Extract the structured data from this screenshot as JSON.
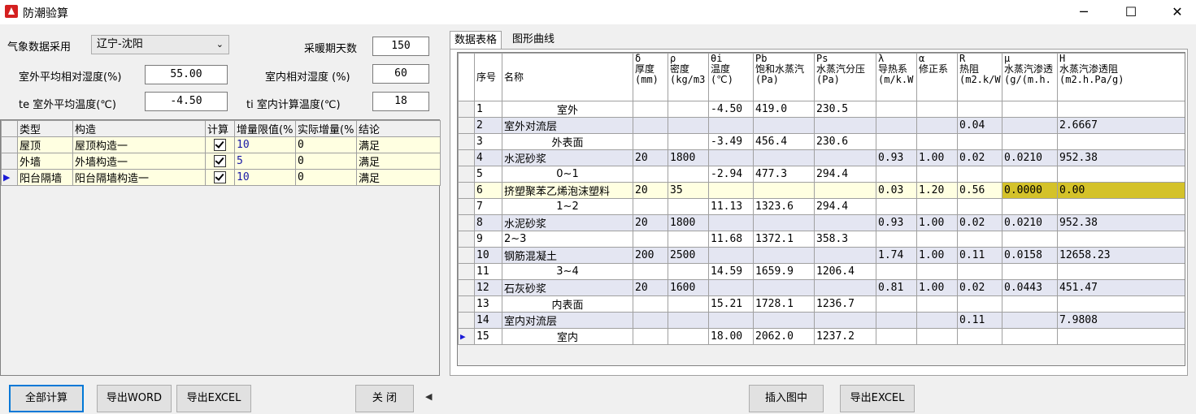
{
  "window": {
    "title": "防潮验算",
    "minimize": "─",
    "maximize": "☐",
    "close": "✕"
  },
  "form": {
    "region_label": "气象数据采用",
    "region_value": "辽宁-沈阳",
    "heating_days_label": "采暖期天数",
    "heating_days_value": "150",
    "outdoor_rh_label": "室外平均相对湿度(%)",
    "outdoor_rh_value": "55.00",
    "indoor_rh_label": "室内相对湿度 (%)",
    "indoor_rh_value": "60",
    "te_label": "te 室外平均温度(℃)",
    "te_value": "-4.50",
    "ti_label": "ti 室内计算温度(℃)",
    "ti_value": "18"
  },
  "left_table": {
    "headers": [
      "类型",
      "构造",
      "计算",
      "增量限值(%",
      "实际增量(%",
      "结论"
    ],
    "rows": [
      {
        "type": "屋顶",
        "construction": "屋顶构造一",
        "limit": "10",
        "actual": "0",
        "result": "满足"
      },
      {
        "type": "外墙",
        "construction": "外墙构造一",
        "limit": "5",
        "actual": "0",
        "result": "满足"
      },
      {
        "type": "阳台隔墙",
        "construction": "阳台隔墙构造一",
        "limit": "10",
        "actual": "0",
        "result": "满足"
      }
    ]
  },
  "tabs": [
    "数据表格",
    "图形曲线"
  ],
  "right_table": {
    "headers": [
      [
        "序号"
      ],
      [
        "名称"
      ],
      [
        "δ",
        "厚度",
        "(mm)"
      ],
      [
        "ρ",
        "密度",
        "(kg/m3"
      ],
      [
        "θi",
        "温度",
        "(℃)"
      ],
      [
        "Pb",
        "饱和水蒸汽",
        "(Pa)"
      ],
      [
        "Ps",
        "水蒸汽分压",
        "(Pa)"
      ],
      [
        "λ",
        "导热系",
        "(m/k.W"
      ],
      [
        "α",
        "修正系"
      ],
      [
        "R",
        "热阻",
        "(m2.k/W"
      ],
      [
        "μ",
        "水蒸汽渗透",
        "(g/(m.h."
      ],
      [
        "H",
        "水蒸汽渗透阻",
        "(m2.h.Pa/g)"
      ]
    ],
    "rows": [
      [
        "1",
        "室外",
        "",
        "",
        "-4.50",
        "419.0",
        "230.5",
        "",
        "",
        "",
        "",
        ""
      ],
      [
        "2",
        "室外对流层",
        "",
        "",
        "",
        "",
        "",
        "",
        "",
        "0.04",
        "",
        "2.6667"
      ],
      [
        "3",
        "外表面",
        "",
        "",
        "-3.49",
        "456.4",
        "230.6",
        "",
        "",
        "",
        "",
        ""
      ],
      [
        "4",
        "水泥砂浆",
        "20",
        "1800",
        "",
        "",
        "",
        "0.93",
        "1.00",
        "0.02",
        "0.0210",
        "952.38"
      ],
      [
        "5",
        "0~1",
        "",
        "",
        "-2.94",
        "477.3",
        "294.4",
        "",
        "",
        "",
        "",
        ""
      ],
      [
        "6",
        "挤塑聚苯乙烯泡沫塑料",
        "20",
        "35",
        "",
        "",
        "",
        "0.03",
        "1.20",
        "0.56",
        "0.0000",
        "0.00"
      ],
      [
        "7",
        "1~2",
        "",
        "",
        "11.13",
        "1323.6",
        "294.4",
        "",
        "",
        "",
        "",
        ""
      ],
      [
        "8",
        "水泥砂浆",
        "20",
        "1800",
        "",
        "",
        "",
        "0.93",
        "1.00",
        "0.02",
        "0.0210",
        "952.38"
      ],
      [
        "9",
        "2~3",
        "",
        "",
        "11.68",
        "1372.1",
        "358.3",
        "",
        "",
        "",
        "",
        ""
      ],
      [
        "10",
        "钢筋混凝土",
        "200",
        "2500",
        "",
        "",
        "",
        "1.74",
        "1.00",
        "0.11",
        "0.0158",
        "12658.23"
      ],
      [
        "11",
        "3~4",
        "",
        "",
        "14.59",
        "1659.9",
        "1206.4",
        "",
        "",
        "",
        "",
        ""
      ],
      [
        "12",
        "石灰砂浆",
        "20",
        "1600",
        "",
        "",
        "",
        "0.81",
        "1.00",
        "0.02",
        "0.0443",
        "451.47"
      ],
      [
        "13",
        "内表面",
        "",
        "",
        "15.21",
        "1728.1",
        "1236.7",
        "",
        "",
        "",
        "",
        ""
      ],
      [
        "14",
        "室内对流层",
        "",
        "",
        "",
        "",
        "",
        "",
        "",
        "0.11",
        "",
        "7.9808"
      ],
      [
        "15",
        "室内",
        "",
        "",
        "18.00",
        "2062.0",
        "1237.2",
        "",
        "",
        "",
        "",
        ""
      ]
    ]
  },
  "buttons": {
    "calc_all": "全部计算",
    "export_word": "导出WORD",
    "export_excel_left": "导出EXCEL",
    "close": "关 闭",
    "insert_drawing": "插入图中",
    "export_excel_right": "导出EXCEL"
  }
}
